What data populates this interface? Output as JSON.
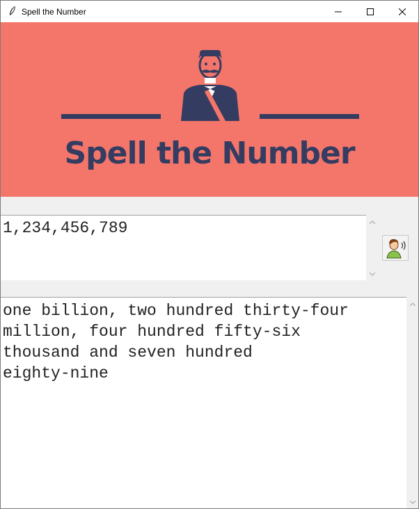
{
  "window": {
    "title": "Spell the Number",
    "controls": [
      "minimize-icon",
      "maximize-icon",
      "close-icon"
    ]
  },
  "banner": {
    "title": "Spell the Number",
    "background": "#f4766a",
    "ink": "#353c61"
  },
  "input": {
    "value": "1,234,456,789"
  },
  "speak_button": {
    "icon": "speaking-person-icon"
  },
  "output": {
    "text": "one billion, two hundred thirty-four\nmillion, four hundred fifty-six\nthousand and seven hundred\neighty-nine"
  }
}
